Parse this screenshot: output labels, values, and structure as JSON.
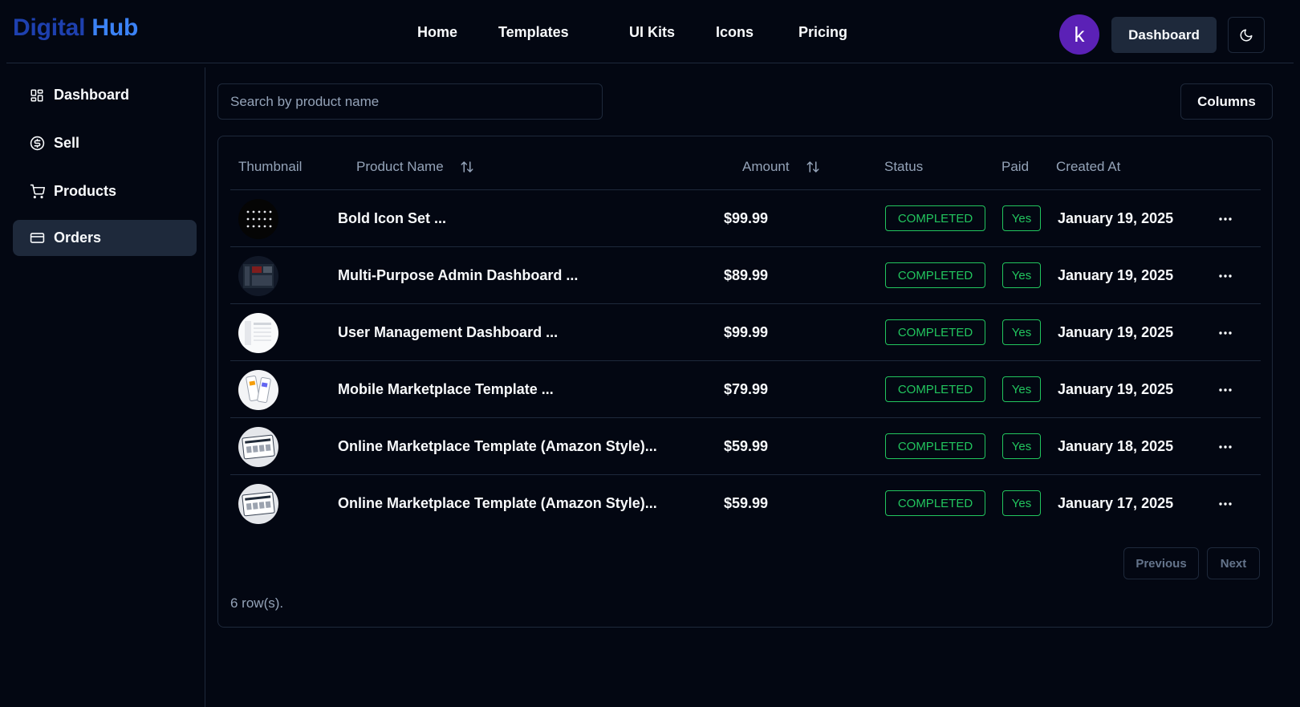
{
  "brand": {
    "part1": "Digital",
    "part2": "Hub"
  },
  "nav": [
    "Home",
    "Templates",
    "UI Kits",
    "Icons",
    "Pricing"
  ],
  "header": {
    "avatar_letter": "k",
    "dashboard_label": "Dashboard",
    "theme_icon": "moon-icon"
  },
  "sidebar": {
    "items": [
      {
        "label": "Dashboard",
        "icon": "grid-icon"
      },
      {
        "label": "Sell",
        "icon": "dollar-circle-icon"
      },
      {
        "label": "Products",
        "icon": "cart-icon"
      },
      {
        "label": "Orders",
        "icon": "card-icon",
        "active": true
      }
    ]
  },
  "toolbar": {
    "search_placeholder": "Search by product name",
    "columns_label": "Columns"
  },
  "table": {
    "headers": {
      "thumbnail": "Thumbnail",
      "product_name": "Product Name",
      "amount": "Amount",
      "status": "Status",
      "paid": "Paid",
      "created_at": "Created At"
    },
    "rows": [
      {
        "thumb": "dark-icon-grid",
        "product": "Bold Icon Set ...",
        "amount": "$99.99",
        "status": "COMPLETED",
        "paid": "Yes",
        "created": "January 19, 2025"
      },
      {
        "thumb": "dark-dashboard",
        "product": "Multi-Purpose Admin Dashboard ...",
        "amount": "$89.99",
        "status": "COMPLETED",
        "paid": "Yes",
        "created": "January 19, 2025"
      },
      {
        "thumb": "light-dashboard",
        "product": "User Management Dashboard ...",
        "amount": "$99.99",
        "status": "COMPLETED",
        "paid": "Yes",
        "created": "January 19, 2025"
      },
      {
        "thumb": "mobile-screens",
        "product": "Mobile Marketplace Template ...",
        "amount": "$79.99",
        "status": "COMPLETED",
        "paid": "Yes",
        "created": "January 19, 2025"
      },
      {
        "thumb": "marketplace-screen",
        "product": "Online Marketplace Template (Amazon Style)...",
        "amount": "$59.99",
        "status": "COMPLETED",
        "paid": "Yes",
        "created": "January 18, 2025"
      },
      {
        "thumb": "marketplace-screen",
        "product": "Online Marketplace Template (Amazon Style)...",
        "amount": "$59.99",
        "status": "COMPLETED",
        "paid": "Yes",
        "created": "January 17, 2025"
      }
    ]
  },
  "pagination": {
    "previous": "Previous",
    "next": "Next",
    "row_count": "6 row(s)."
  },
  "colors": {
    "background": "#030712",
    "border": "#1e293b",
    "accent_green": "#22c55e",
    "brand_dark": "#1e40af",
    "brand_light": "#3b82f6",
    "avatar": "#5b21b6"
  }
}
